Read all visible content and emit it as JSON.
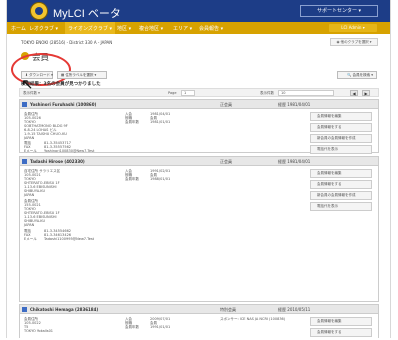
{
  "brand": "MyLCI ベータ",
  "support": "サポートセンター ▾",
  "nav": {
    "items": [
      "ホーム",
      "レオクラブ ▾",
      "ライオンズクラブ ▾",
      "地区 ▾",
      "複合地区 ▾",
      "エリア ▾",
      "会員報告 ▾"
    ],
    "admin": "LCI Admin ▾"
  },
  "breadcrumb": "TOKYO ENOKI (28516) - District 330 A - JAPAN",
  "club_button": "◉ 他のクラブを選択 ▾",
  "title": "会員",
  "toolbar": {
    "download": "⬇ ダウンロード ▾",
    "address": "▦ 住所ラベルを選択 ▾",
    "search": "🔍 会員を検索 ▾"
  },
  "found_message": "検索結果：3名の会員が見つかりました",
  "pager": {
    "show": "表示件数 ▾",
    "page": "Page",
    "page_value": "1",
    "per_page": "表示件数",
    "per_page_value": "10",
    "prev": "◀",
    "next": "▶"
  },
  "labels": {
    "position": "役職",
    "join": "入会",
    "status": "状態",
    "member_since": "会員歴",
    "phone": "電話",
    "fax": "FAX",
    "email": "Eメール"
  },
  "members": [
    {
      "name": "Yoshinori Furuhashi (100860)",
      "position_col": "正会員",
      "history_col": "経歴 1981/04/01",
      "sponsor": "",
      "address": [
        "会員住所",
        "105-0026",
        "TOKYO",
        "SOBTHATMONO BLDG 9F",
        "6-8-24 LOHAS ビル",
        "1-9-15 TAISHU CHUO-KU",
        "JAPAN"
      ],
      "phone": "81-3-35453717",
      "fax": "81-3-35557562",
      "email": "Yoshinori100830@New7.Test",
      "info": [
        [
          "入会",
          "1981/04/01"
        ],
        [
          "役職",
          "会員"
        ],
        [
          "会員年数",
          "1981/01/01"
        ]
      ],
      "actions": [
        "会員情報を編集",
        "会員情報をする",
        "新会員の会員情報を作成",
        "電話代を表示"
      ]
    },
    {
      "name": "Tadashi Hirose (402330)",
      "position_col": "正会員",
      "history_col": "経歴 1981/04/01",
      "sponsor": "",
      "address": [
        "自宅住所 サラリエス区",
        "105-0021",
        "TOKYO",
        "SHTERATO-EBISU 1F",
        "1-13-6 EBISUNISHI",
        "SHIBUYA-KU",
        "JAPAN",
        "会員住所",
        "155-0021",
        "TOKYO",
        "SHTERATO-EBISU 1F",
        "1-13-6 EBISUNISHI",
        "SHIBUYA-KU",
        "JAPAN"
      ],
      "phone": "81-3-34554662",
      "fax": "81-3-34613426",
      "email": "Tadashi1100995@New7.Test",
      "info": [
        [
          "入会",
          "1991/02/01"
        ],
        [
          "役職",
          "会員"
        ],
        [
          "会員年数",
          "1988/01/01"
        ]
      ],
      "actions": [
        "会員情報を編集",
        "会員情報をする",
        "新会員の会員情報を作成",
        "電話代を表示"
      ]
    },
    {
      "name": "Chikatoshi Hemaga (2836184)",
      "position_col": "特別会員",
      "history_col": "経歴 2010/05/11",
      "sponsor": "スポンサー: ICE NAS JA NCRI (100836)",
      "address": [
        "会員住所",
        "105-0022",
        "T5",
        "TOKYO Yokalls01"
      ],
      "phone": "",
      "fax": "",
      "email": "",
      "info": [
        [
          "入会",
          "2009/07/01"
        ],
        [
          "役職",
          "会員"
        ],
        [
          "会員年数",
          "1991/01/01"
        ]
      ],
      "actions": [
        "会員情報を編集",
        "会員情報をする"
      ]
    }
  ],
  "colors": {
    "topbar": "#1d3d87",
    "navbar": "#d7a200",
    "highlight_ring": "#e53935"
  }
}
